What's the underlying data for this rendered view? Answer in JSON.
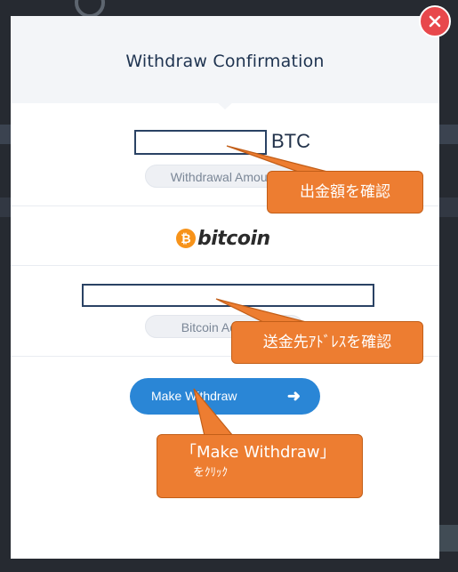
{
  "modal": {
    "title": "Withdraw Confirmation",
    "close_icon": "close-icon"
  },
  "amount": {
    "input_value": "",
    "unit": "BTC",
    "label": "Withdrawal Amount"
  },
  "logo": {
    "coin_glyph": "₿",
    "text": "bitcoin"
  },
  "address": {
    "input_value": "",
    "label": "Bitcoin Address"
  },
  "action": {
    "make_withdraw_label": "Make Withdraw",
    "arrow_icon": "arrow-right-icon"
  },
  "annotations": {
    "confirm_amount": "出金額を確認",
    "confirm_address": "送金先ｱﾄﾞﾚｽを確認",
    "click_line1": "「Make Withdraw」",
    "click_line2": "をｸﾘｯｸ"
  },
  "colors": {
    "accent": "#2a86d6",
    "callout": "#ed7d31",
    "close": "#e8484c",
    "title": "#1e3350"
  }
}
